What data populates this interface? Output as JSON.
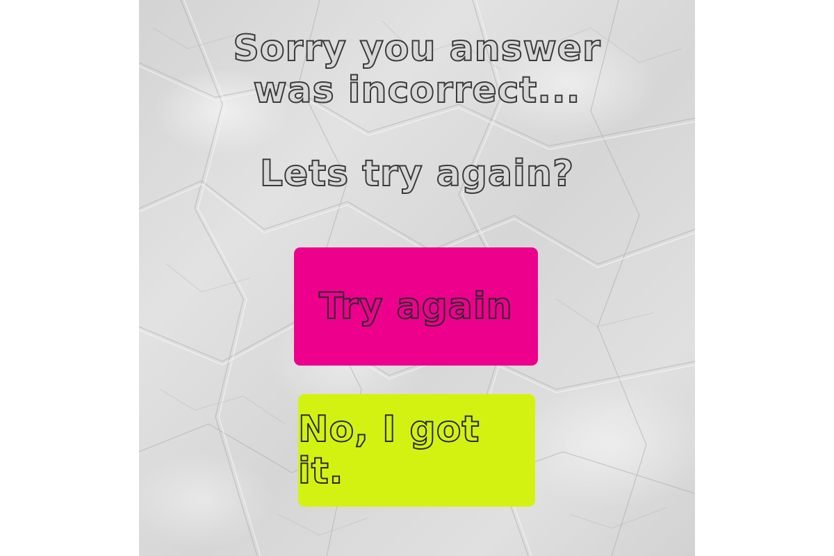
{
  "message": {
    "line_1": "Sorry you answer",
    "line_2": "was incorrect...",
    "prompt": "Lets try again?"
  },
  "buttons": {
    "try_again": {
      "label": "Try again",
      "color": "#ec008c"
    },
    "got_it": {
      "label": "No, I got it.",
      "color": "#d4f212"
    }
  },
  "background": {
    "texture": "crumpled-paper",
    "color": "#dcdcdc"
  }
}
